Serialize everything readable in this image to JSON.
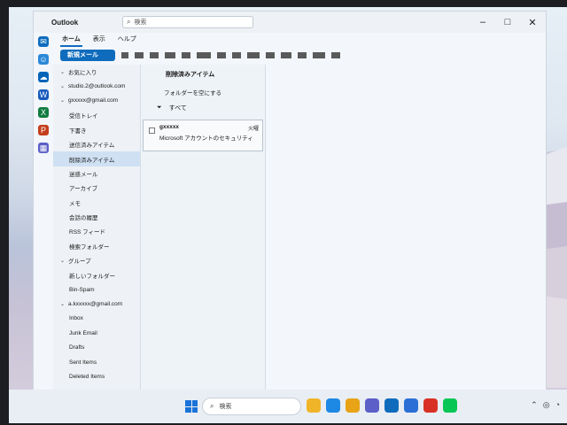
{
  "window": {
    "app_name": "Outlook",
    "search_placeholder": "検索",
    "controls": [
      "–",
      "□",
      "✕"
    ]
  },
  "tabs": [
    "ホーム",
    "表示",
    "ヘルプ"
  ],
  "ribbon": {
    "new_mail": "新規メール"
  },
  "rail_icons": [
    "mail-icon",
    "people-icon",
    "onedrive-icon",
    "word-icon",
    "excel-icon",
    "powerpoint-icon",
    "apps-icon"
  ],
  "folders": {
    "items": [
      {
        "label": "お気に入り",
        "level": 0
      },
      {
        "label": "studio.2@outlook.com",
        "level": 0
      },
      {
        "label": "gxxxxx@gmail.com",
        "level": 0
      },
      {
        "label": "受信トレイ",
        "level": 1
      },
      {
        "label": "下書き",
        "level": 1
      },
      {
        "label": "送信済みアイテム",
        "level": 1
      },
      {
        "label": "削除済みアイテム",
        "level": 1
      },
      {
        "label": "迷惑メール",
        "level": 1
      },
      {
        "label": "アーカイブ",
        "level": 1
      },
      {
        "label": "メモ",
        "level": 1
      },
      {
        "label": "会話の履歴",
        "level": 1
      },
      {
        "label": "RSS フィード",
        "level": 1
      },
      {
        "label": "検索フォルダー",
        "level": 1
      },
      {
        "label": "グループ",
        "level": 0
      },
      {
        "label": "新しいフォルダー",
        "level": 1
      },
      {
        "label": "Bin-Spam",
        "level": 1
      },
      {
        "label": "a.kxxxxx@gmail.com",
        "level": 0
      },
      {
        "label": "Inbox",
        "level": 1
      },
      {
        "label": "Junk Email",
        "level": 1
      },
      {
        "label": "Drafts",
        "level": 1
      },
      {
        "label": "Sent Items",
        "level": 1
      },
      {
        "label": "Deleted Items",
        "level": 1
      }
    ],
    "selected_index": 6
  },
  "message_list": {
    "header": "削除済みアイテム",
    "subheader": "フォルダーを空にする",
    "filter": "すべて",
    "messages": [
      {
        "from": "gxxxxx",
        "subject": "Microsoft アカウントのセキュリティ",
        "time": "火曜"
      }
    ]
  },
  "taskbar": {
    "search_placeholder": "検索",
    "apps": [
      {
        "name": "file-explorer-icon",
        "color": "#f0b429"
      },
      {
        "name": "edge-icon",
        "color": "#1e88e5"
      },
      {
        "name": "folder-icon",
        "color": "#e8a317"
      },
      {
        "name": "teams-icon",
        "color": "#5b5fc7"
      },
      {
        "name": "outlook-icon",
        "color": "#0f6cbd"
      },
      {
        "name": "store-icon",
        "color": "#2b6fd6"
      },
      {
        "name": "app-red-icon",
        "color": "#d93025"
      },
      {
        "name": "line-icon",
        "color": "#06c755"
      }
    ]
  },
  "colors": {
    "accent": "#0f6cbd",
    "selection": "#cfe0f3"
  }
}
